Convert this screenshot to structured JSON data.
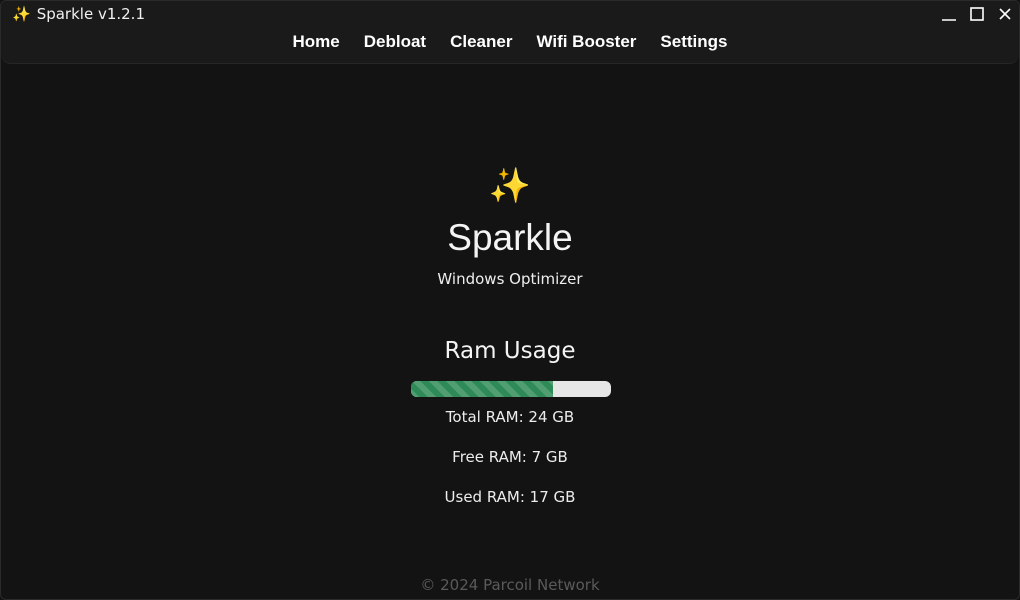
{
  "window": {
    "title": "Sparkle v1.2.1",
    "title_icon": "sparkles-icon"
  },
  "nav": {
    "items": [
      {
        "label": "Home"
      },
      {
        "label": "Debloat"
      },
      {
        "label": "Cleaner"
      },
      {
        "label": "Wifi Booster"
      },
      {
        "label": "Settings"
      }
    ]
  },
  "hero": {
    "icon": "✨",
    "app_name": "Sparkle",
    "subtitle": "Windows Optimizer"
  },
  "ram": {
    "title": "Ram Usage",
    "used_fraction": 0.71,
    "bar_color": "#2e8b57",
    "total": "Total RAM: 24 GB",
    "free": "Free RAM: 7 GB",
    "used": "Used RAM: 17 GB"
  },
  "footer": {
    "text": "© 2024 Parcoil Network"
  }
}
